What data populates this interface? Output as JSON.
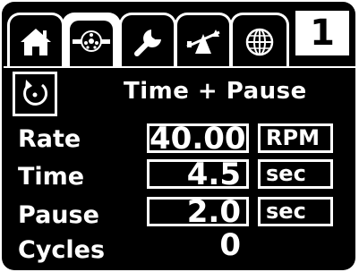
{
  "tabs": [
    {
      "icon": "home-icon",
      "active": false
    },
    {
      "icon": "pump-icon",
      "active": true
    },
    {
      "icon": "wrench-icon",
      "active": false
    },
    {
      "icon": "balance-icon",
      "active": false
    },
    {
      "icon": "globe-icon",
      "active": false
    }
  ],
  "page_number": "1",
  "mode": {
    "icon": "rotate-icon",
    "title": "Time + Pause"
  },
  "params": [
    {
      "label": "Rate",
      "value": "40.00",
      "unit": "RPM"
    },
    {
      "label": "Time",
      "value": "4.5",
      "unit": "sec"
    },
    {
      "label": "Pause",
      "value": "2.0",
      "unit": "sec"
    },
    {
      "label": "Cycles",
      "value": "0",
      "unit": ""
    }
  ],
  "colors": {
    "background": "#000000",
    "foreground": "#ffffff"
  }
}
